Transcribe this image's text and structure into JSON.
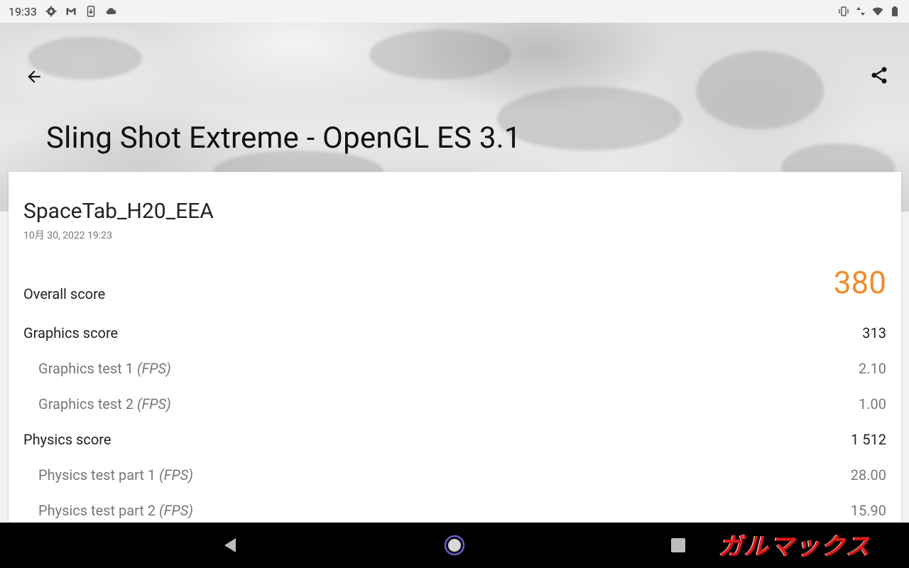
{
  "status_bar": {
    "time": "19:33",
    "left_icons": [
      "gear-icon",
      "gmail-icon",
      "download-icon",
      "cloud-icon"
    ],
    "right_icons": [
      "vibrate-icon",
      "data-arrows-icon",
      "wifi-icon",
      "battery-icon"
    ]
  },
  "header": {
    "title": "Sling Shot Extreme - OpenGL ES 3.1",
    "back_icon": "arrow-back-icon",
    "share_icon": "share-icon"
  },
  "result": {
    "device_name": "SpaceTab_H20_EEA",
    "date": "10月 30, 2022 19:23",
    "overall": {
      "label": "Overall score",
      "value": "380",
      "accent_color": "#f08c2c"
    },
    "graphics": {
      "label": "Graphics score",
      "value": "313",
      "tests": [
        {
          "label": "Graphics test 1",
          "unit": "(FPS)",
          "value": "2.10"
        },
        {
          "label": "Graphics test 2",
          "unit": "(FPS)",
          "value": "1.00"
        }
      ]
    },
    "physics": {
      "label": "Physics score",
      "value": "1 512",
      "tests": [
        {
          "label": "Physics test part 1",
          "unit": "(FPS)",
          "value": "28.00"
        },
        {
          "label": "Physics test part 2",
          "unit": "(FPS)",
          "value": "15.90"
        }
      ]
    }
  },
  "nav_bar": {
    "back": "nav-back-icon",
    "home": "nav-home-icon",
    "recents": "nav-recents-icon",
    "watermark_text": "ガルマックス"
  }
}
